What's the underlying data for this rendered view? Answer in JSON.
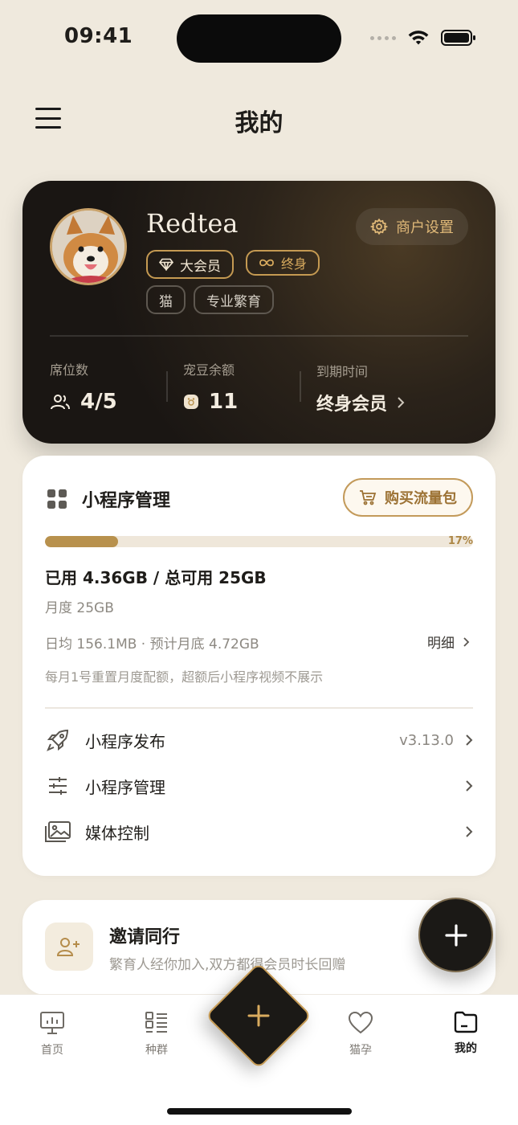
{
  "status": {
    "time": "09:41"
  },
  "header": {
    "title": "我的"
  },
  "profile": {
    "name": "Redtea",
    "merchant_settings": "商户设置",
    "badge_vip": "大会员",
    "badge_lifetime": "终身",
    "tags": [
      "猫",
      "专业繁育"
    ],
    "stats": [
      {
        "label": "席位数",
        "value": "4/5",
        "icon": "users-icon"
      },
      {
        "label": "宠豆余额",
        "value": "11",
        "icon": "pet-bean-icon"
      },
      {
        "label": "到期时间",
        "value": "终身会员",
        "icon": "chevron-right-icon"
      }
    ]
  },
  "storage": {
    "title": "小程序管理",
    "buy_button": "购买流量包",
    "progress_percent": 17,
    "progress_label": "17%",
    "used_line": "已用 4.36GB / 总可用 25GB",
    "monthly": "月度 25GB",
    "daily": "日均 156.1MB · 预计月底 4.72GB",
    "detail_link": "明细",
    "note": "每月1号重置月度配额，超额后小程序视频不展示",
    "menu": [
      {
        "label": "小程序发布",
        "version": "v3.13.0",
        "icon": "rocket-icon"
      },
      {
        "label": "小程序管理",
        "version": "",
        "icon": "sliders-icon"
      },
      {
        "label": "媒体控制",
        "version": "",
        "icon": "media-icon"
      }
    ]
  },
  "invite": {
    "title": "邀请同行",
    "subtitle": "繁育人经你加入,双方都得会员时长回赠"
  },
  "tabs": [
    {
      "label": "首页",
      "icon": "monitor-icon",
      "active": false
    },
    {
      "label": "种群",
      "icon": "list-icon",
      "active": false
    },
    {
      "label": "猫孕",
      "icon": "heart-icon",
      "active": false
    },
    {
      "label": "我的",
      "icon": "folder-icon",
      "active": true
    }
  ],
  "colors": {
    "background": "#efe9dd",
    "accent_gold": "#b8914d",
    "card_dark": "#1a1613"
  }
}
